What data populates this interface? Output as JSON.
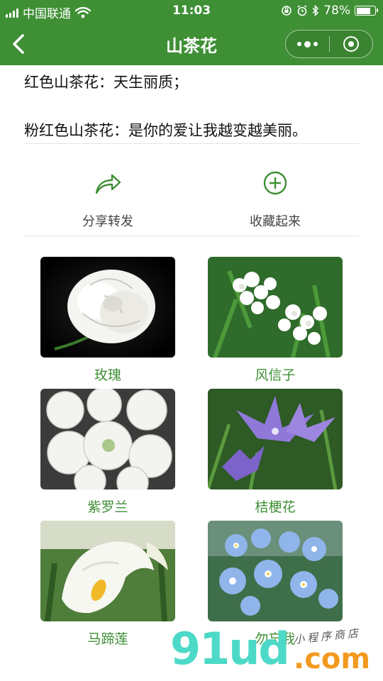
{
  "status_bar": {
    "carrier": "中国联通",
    "time": "11:03",
    "battery_percent": "78%",
    "battery_level": 0.78
  },
  "nav": {
    "title": "山茶花"
  },
  "content": {
    "line1": "红色山茶花：天生丽质；",
    "line2": "粉红色山茶花：是你的爱让我越变越美丽。"
  },
  "actions": {
    "share_label": "分享转发",
    "share_icon": "share-arrow-icon",
    "collect_label": "收藏起来",
    "collect_icon": "plus-circle-icon"
  },
  "flowers": [
    {
      "name": "玫瑰"
    },
    {
      "name": "风信子"
    },
    {
      "name": "紫罗兰"
    },
    {
      "name": "桔梗花"
    },
    {
      "name": "马蹄莲"
    },
    {
      "name": "勿忘我"
    }
  ],
  "watermark": {
    "brand": "91ud",
    "domain": ".com",
    "tagline": "小程序商店"
  },
  "colors": {
    "brand_green": "#3f8f35",
    "watermark_teal": "#4dd9c8",
    "watermark_orange": "#f39a1e"
  }
}
